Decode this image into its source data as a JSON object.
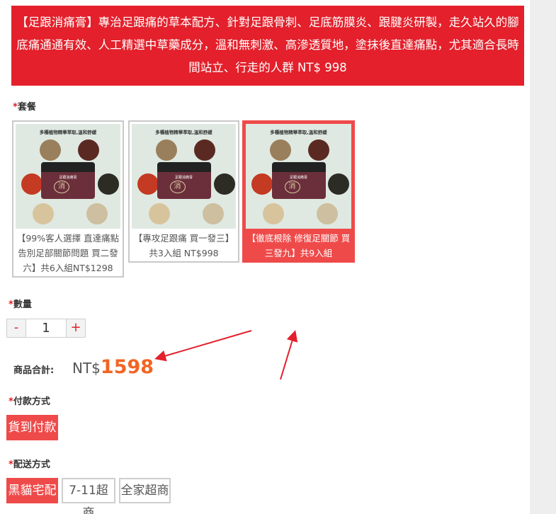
{
  "banner": {
    "text": "【足跟消痛膏】專治足跟痛的草本配方、針對足跟骨刺、足底筋膜炎、跟腱炎研製，走久站久的腳底痛通通有效、人工精選中草藥成分，溫和無刺激、高滲透質地，塗抹後直達痛點，尤其適合長時間站立、行走的人群 NT$ 998"
  },
  "required_mark": "*",
  "package": {
    "label": "套餐",
    "options": [
      {
        "caption": "【99%客人選擇 直達痛點 告別足部關節問題 買二發六】共6入組NT$1298",
        "selected": false,
        "image": {
          "header": "多種植物精華萃取,溫和舒緩",
          "jar_label": "足跟消痛膏",
          "seal": "消"
        }
      },
      {
        "caption": "【專攻足跟痛 買一發三】共3入組 NT$998",
        "selected": false,
        "image": {
          "header": "多種植物精華萃取,溫和舒緩",
          "jar_label": "足跟消痛膏",
          "seal": "消"
        }
      },
      {
        "caption": "【徹底根除 修復足關節 買三發九】共9入組 NT$1598",
        "selected": true,
        "image": {
          "header": "多種植物精華萃取,溫和舒緩",
          "jar_label": "足跟消痛膏",
          "seal": "消"
        }
      }
    ]
  },
  "quantity": {
    "label": "數量",
    "minus": "-",
    "value": "1",
    "plus": "+"
  },
  "total": {
    "label": "商品合計:",
    "currency": "NT$",
    "amount": "1598"
  },
  "payment": {
    "label": "付款方式",
    "options": [
      {
        "text": "貨到付款",
        "selected": true
      }
    ]
  },
  "shipping": {
    "label": "配送方式",
    "options": [
      {
        "text": "黑貓宅配",
        "selected": true
      },
      {
        "text": "7-11超商",
        "selected": false
      },
      {
        "text": "全家超商",
        "selected": false
      }
    ]
  },
  "colors": {
    "banner_bg": "#e3202b",
    "selected_bg": "#ef4a4a",
    "price": "#f26522",
    "annotation_arrow": "#e3202b"
  }
}
